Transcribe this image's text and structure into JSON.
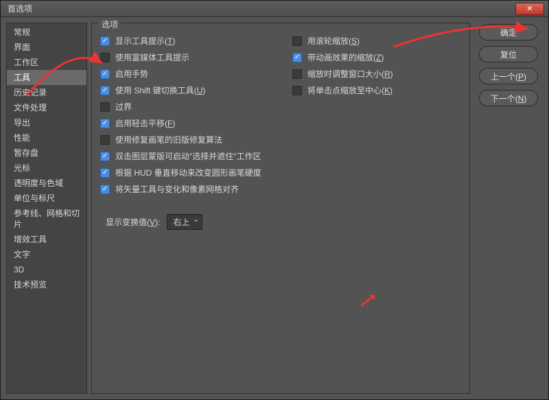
{
  "window": {
    "title": "首选项"
  },
  "sidebar": {
    "items": [
      {
        "label": "常规"
      },
      {
        "label": "界面"
      },
      {
        "label": "工作区"
      },
      {
        "label": "工具"
      },
      {
        "label": "历史记录"
      },
      {
        "label": "文件处理"
      },
      {
        "label": "导出"
      },
      {
        "label": "性能"
      },
      {
        "label": "暂存盘"
      },
      {
        "label": "光标"
      },
      {
        "label": "透明度与色域"
      },
      {
        "label": "单位与标尺"
      },
      {
        "label": "参考线、网格和切片"
      },
      {
        "label": "增效工具"
      },
      {
        "label": "文字"
      },
      {
        "label": "3D"
      },
      {
        "label": "技术预览"
      }
    ],
    "selected_index": 3
  },
  "options": {
    "group_label": "选项",
    "left": [
      {
        "checked": true,
        "label_pre": "显示工具提示(",
        "hotkey": "T",
        "label_post": ")"
      },
      {
        "checked": false,
        "label_pre": "使用富媒体工具提示",
        "hotkey": "",
        "label_post": ""
      },
      {
        "checked": true,
        "label_pre": "启用手势",
        "hotkey": "",
        "label_post": ""
      },
      {
        "checked": true,
        "label_pre": "使用 Shift 键切换工具(",
        "hotkey": "U",
        "label_post": ")"
      },
      {
        "checked": false,
        "label_pre": "过界",
        "hotkey": "",
        "label_post": ""
      },
      {
        "checked": true,
        "label_pre": "启用轻击平移(",
        "hotkey": "F",
        "label_post": ")"
      },
      {
        "checked": false,
        "label_pre": "使用修复画笔的旧版修复算法",
        "hotkey": "",
        "label_post": ""
      },
      {
        "checked": true,
        "label_pre": "双击图层蒙版可启动\"选择并遮住\"工作区",
        "hotkey": "",
        "label_post": ""
      },
      {
        "checked": true,
        "label_pre": "根据 HUD 垂直移动来改变圆形画笔硬度",
        "hotkey": "",
        "label_post": ""
      },
      {
        "checked": true,
        "label_pre": "将矢量工具与变化和像素网格对齐",
        "hotkey": "",
        "label_post": ""
      }
    ],
    "right": [
      {
        "checked": false,
        "label_pre": "用滚轮缩放(",
        "hotkey": "S",
        "label_post": ")"
      },
      {
        "checked": true,
        "label_pre": "带动画效果的缩放(",
        "hotkey": "Z",
        "label_post": ")"
      },
      {
        "checked": false,
        "label_pre": "缩放时调整窗口大小(",
        "hotkey": "R",
        "label_post": ")"
      },
      {
        "checked": false,
        "label_pre": "将单击点缩放至中心(",
        "hotkey": "K",
        "label_post": ")"
      }
    ],
    "dropdown": {
      "label_pre": "显示变换值(",
      "hotkey": "V",
      "label_post": "):",
      "selected": "右上"
    }
  },
  "buttons": {
    "ok": "确定",
    "reset": "复位",
    "prev_pre": "上一个(",
    "prev_hk": "P",
    "prev_post": ")",
    "next_pre": "下一个(",
    "next_hk": "N",
    "next_post": ")"
  }
}
